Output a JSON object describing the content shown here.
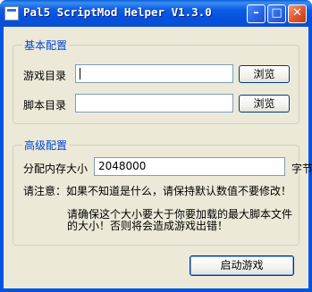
{
  "window": {
    "title": "Pal5 ScriptMod Helper V1.3.0",
    "minimize": "–",
    "maximize": "□",
    "close": "✕"
  },
  "basic": {
    "group_label": "基本配置",
    "game_dir_label": "游戏目录",
    "game_dir_value": "",
    "script_dir_label": "脚本目录",
    "script_dir_value": "",
    "browse_label": "浏览"
  },
  "advanced": {
    "group_label": "高级配置",
    "memory_label": "分配内存大小",
    "memory_value": "2048000",
    "memory_unit": "字节",
    "note1": "请注意：如果不知道是什么，请保持默认数值不要修改！",
    "note2_line1": "请确保这个大小要大于你要加载的最大脚本文件",
    "note2_line2": "的大小！否则将会造成游戏出错！"
  },
  "footer": {
    "launch_label": "启动游戏"
  }
}
